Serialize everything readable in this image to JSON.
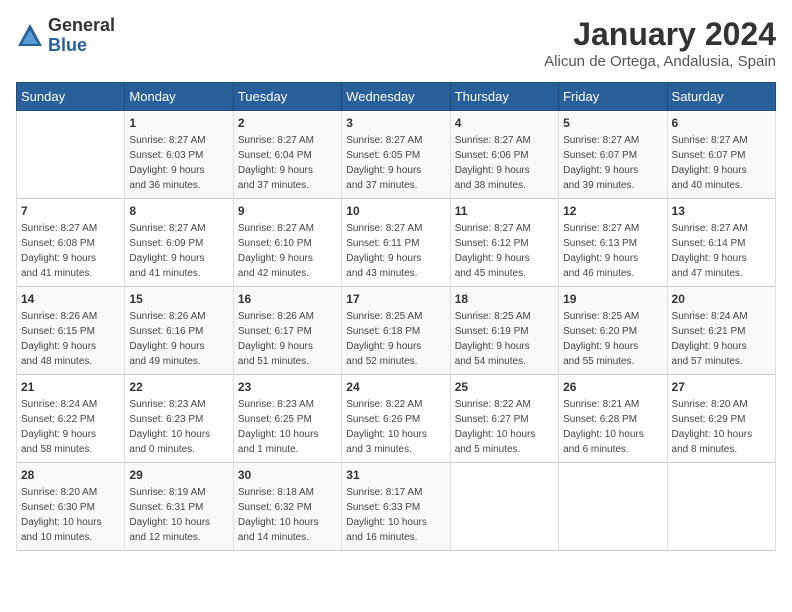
{
  "logo": {
    "general": "General",
    "blue": "Blue"
  },
  "title": "January 2024",
  "location": "Alicun de Ortega, Andalusia, Spain",
  "days_header": [
    "Sunday",
    "Monday",
    "Tuesday",
    "Wednesday",
    "Thursday",
    "Friday",
    "Saturday"
  ],
  "weeks": [
    [
      {
        "num": "",
        "info": ""
      },
      {
        "num": "1",
        "info": "Sunrise: 8:27 AM\nSunset: 6:03 PM\nDaylight: 9 hours\nand 36 minutes."
      },
      {
        "num": "2",
        "info": "Sunrise: 8:27 AM\nSunset: 6:04 PM\nDaylight: 9 hours\nand 37 minutes."
      },
      {
        "num": "3",
        "info": "Sunrise: 8:27 AM\nSunset: 6:05 PM\nDaylight: 9 hours\nand 37 minutes."
      },
      {
        "num": "4",
        "info": "Sunrise: 8:27 AM\nSunset: 6:06 PM\nDaylight: 9 hours\nand 38 minutes."
      },
      {
        "num": "5",
        "info": "Sunrise: 8:27 AM\nSunset: 6:07 PM\nDaylight: 9 hours\nand 39 minutes."
      },
      {
        "num": "6",
        "info": "Sunrise: 8:27 AM\nSunset: 6:07 PM\nDaylight: 9 hours\nand 40 minutes."
      }
    ],
    [
      {
        "num": "7",
        "info": "Sunrise: 8:27 AM\nSunset: 6:08 PM\nDaylight: 9 hours\nand 41 minutes."
      },
      {
        "num": "8",
        "info": "Sunrise: 8:27 AM\nSunset: 6:09 PM\nDaylight: 9 hours\nand 41 minutes."
      },
      {
        "num": "9",
        "info": "Sunrise: 8:27 AM\nSunset: 6:10 PM\nDaylight: 9 hours\nand 42 minutes."
      },
      {
        "num": "10",
        "info": "Sunrise: 8:27 AM\nSunset: 6:11 PM\nDaylight: 9 hours\nand 43 minutes."
      },
      {
        "num": "11",
        "info": "Sunrise: 8:27 AM\nSunset: 6:12 PM\nDaylight: 9 hours\nand 45 minutes."
      },
      {
        "num": "12",
        "info": "Sunrise: 8:27 AM\nSunset: 6:13 PM\nDaylight: 9 hours\nand 46 minutes."
      },
      {
        "num": "13",
        "info": "Sunrise: 8:27 AM\nSunset: 6:14 PM\nDaylight: 9 hours\nand 47 minutes."
      }
    ],
    [
      {
        "num": "14",
        "info": "Sunrise: 8:26 AM\nSunset: 6:15 PM\nDaylight: 9 hours\nand 48 minutes."
      },
      {
        "num": "15",
        "info": "Sunrise: 8:26 AM\nSunset: 6:16 PM\nDaylight: 9 hours\nand 49 minutes."
      },
      {
        "num": "16",
        "info": "Sunrise: 8:26 AM\nSunset: 6:17 PM\nDaylight: 9 hours\nand 51 minutes."
      },
      {
        "num": "17",
        "info": "Sunrise: 8:25 AM\nSunset: 6:18 PM\nDaylight: 9 hours\nand 52 minutes."
      },
      {
        "num": "18",
        "info": "Sunrise: 8:25 AM\nSunset: 6:19 PM\nDaylight: 9 hours\nand 54 minutes."
      },
      {
        "num": "19",
        "info": "Sunrise: 8:25 AM\nSunset: 6:20 PM\nDaylight: 9 hours\nand 55 minutes."
      },
      {
        "num": "20",
        "info": "Sunrise: 8:24 AM\nSunset: 6:21 PM\nDaylight: 9 hours\nand 57 minutes."
      }
    ],
    [
      {
        "num": "21",
        "info": "Sunrise: 8:24 AM\nSunset: 6:22 PM\nDaylight: 9 hours\nand 58 minutes."
      },
      {
        "num": "22",
        "info": "Sunrise: 8:23 AM\nSunset: 6:23 PM\nDaylight: 10 hours\nand 0 minutes."
      },
      {
        "num": "23",
        "info": "Sunrise: 8:23 AM\nSunset: 6:25 PM\nDaylight: 10 hours\nand 1 minute."
      },
      {
        "num": "24",
        "info": "Sunrise: 8:22 AM\nSunset: 6:26 PM\nDaylight: 10 hours\nand 3 minutes."
      },
      {
        "num": "25",
        "info": "Sunrise: 8:22 AM\nSunset: 6:27 PM\nDaylight: 10 hours\nand 5 minutes."
      },
      {
        "num": "26",
        "info": "Sunrise: 8:21 AM\nSunset: 6:28 PM\nDaylight: 10 hours\nand 6 minutes."
      },
      {
        "num": "27",
        "info": "Sunrise: 8:20 AM\nSunset: 6:29 PM\nDaylight: 10 hours\nand 8 minutes."
      }
    ],
    [
      {
        "num": "28",
        "info": "Sunrise: 8:20 AM\nSunset: 6:30 PM\nDaylight: 10 hours\nand 10 minutes."
      },
      {
        "num": "29",
        "info": "Sunrise: 8:19 AM\nSunset: 6:31 PM\nDaylight: 10 hours\nand 12 minutes."
      },
      {
        "num": "30",
        "info": "Sunrise: 8:18 AM\nSunset: 6:32 PM\nDaylight: 10 hours\nand 14 minutes."
      },
      {
        "num": "31",
        "info": "Sunrise: 8:17 AM\nSunset: 6:33 PM\nDaylight: 10 hours\nand 16 minutes."
      },
      {
        "num": "",
        "info": ""
      },
      {
        "num": "",
        "info": ""
      },
      {
        "num": "",
        "info": ""
      }
    ]
  ]
}
